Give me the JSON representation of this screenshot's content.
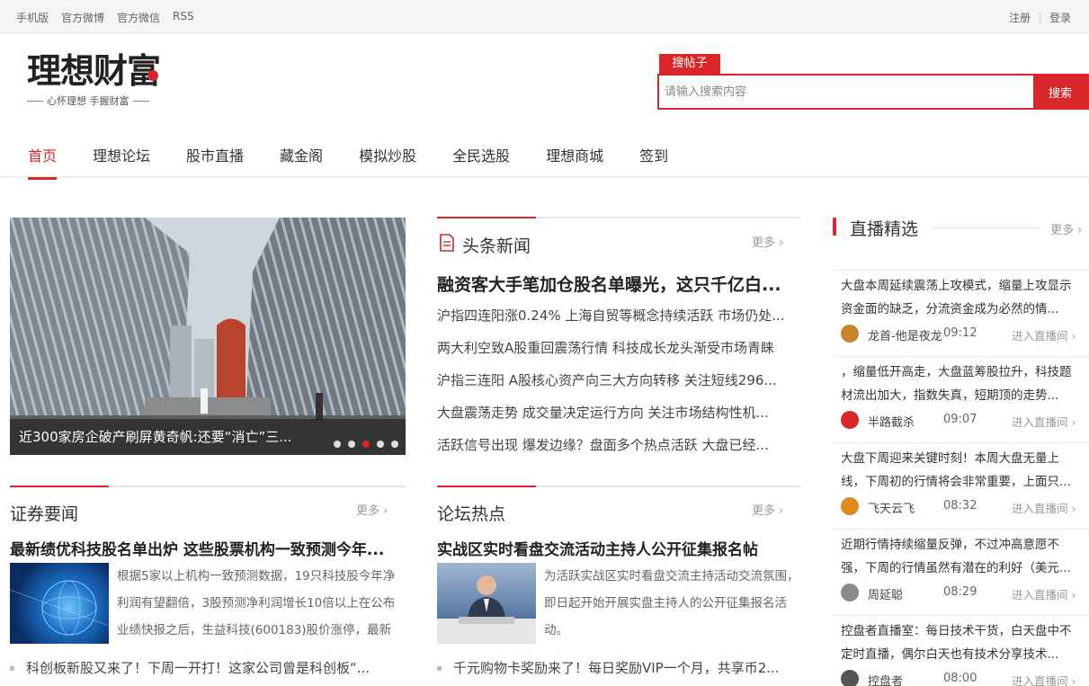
{
  "topbar": {
    "links": [
      "手机版",
      "官方微博",
      "官方微信",
      "RSS"
    ],
    "register": "注册",
    "login": "登录"
  },
  "logo": {
    "main": "理想财富",
    "sub": "心怀理想 手握财富"
  },
  "search": {
    "tab": "搜帖子",
    "placeholder": "请输入搜索内容",
    "button": "搜索"
  },
  "nav": [
    "首页",
    "理想论坛",
    "股市直播",
    "藏金阁",
    "模拟炒股",
    "全民选股",
    "理想商城",
    "签到"
  ],
  "slider": {
    "caption": "近300家房企破产刷屏黄奇帆:还要“消亡”三...",
    "dots": 5,
    "active_dot": 3
  },
  "headline": {
    "title": "头条新闻",
    "more": "更多",
    "top": "融资客大手笔加仓股名单曝光，这只千亿白...",
    "items": [
      "沪指四连阳涨0.24% 上海自贸等概念持续活跃 市场仍处...",
      "两大利空致A股重回震荡行情 科技成长龙头渐受市场青睐",
      "沪指三连阳 A股核心资产向三大方向转移 关注短线296...",
      "大盘震荡走势 成交量决定运行方向 关注市场结构性机...",
      "活跃信号出现 爆发边缘？盘面多个热点活跃 大盘已经..."
    ]
  },
  "securities": {
    "title": "证券要闻",
    "more": "更多",
    "top": "最新绩优科技股名单出炉 这些股票机构一致预测今年...",
    "desc": "根据5家以上机构一致预测数据，19只科技股今年净利润有望翻倍，3股预测净利润增长10倍以上在公布业绩快报之后，生益科技(600183)股价涨停，最新",
    "bullet": "科创板新股又来了！下周一开打！这家公司曾是科创板“..."
  },
  "forum": {
    "title": "论坛热点",
    "more": "更多",
    "top": "实战区实时看盘交流活动主持人公开征集报名帖",
    "desc": "为活跃实战区实时看盘交流主持活动交流氛围，即日起开始开展实盘主持人的公开征集报名活动。",
    "bullet": "千元购物卡奖励来了！每日奖励VIP一个月，共享币2..."
  },
  "live": {
    "title": "直播精选",
    "more": "更多",
    "enter": "进入直播间",
    "items": [
      {
        "text": "大盘本周延续震荡上攻模式，缩量上攻显示资金面的缺乏，分流资金成为必然的情...",
        "author": "龙首-他是夜龙",
        "time": "09:12",
        "avatar": "#c8842a"
      },
      {
        "text": "，缩量低开高走，大盘蓝筹股拉升，科技题材流出加大，指数失真，短期顶的走势...",
        "author": "半路截杀",
        "time": "09:07",
        "avatar": "#d8262b"
      },
      {
        "text": "大盘下周迎来关键时刻！本周大盘无量上线，下周初的行情将会非常重要，上面只...",
        "author": "飞天云飞",
        "time": "08:32",
        "avatar": "#e08a1e"
      },
      {
        "text": "近期行情持续缩量反弹，不过冲高意愿不强，下周的行情虽然有潜在的利好（美元...",
        "author": "周延聪",
        "time": "08:29",
        "avatar": "#8a8a8a"
      },
      {
        "text": "控盘者直播室：每日技术干货，白天盘中不定时直播，偶尔白天也有技术分享技术...",
        "author": "控盘者",
        "time": "08:00",
        "avatar": "#555555"
      }
    ]
  },
  "colors": {
    "accent": "#d8262b"
  }
}
